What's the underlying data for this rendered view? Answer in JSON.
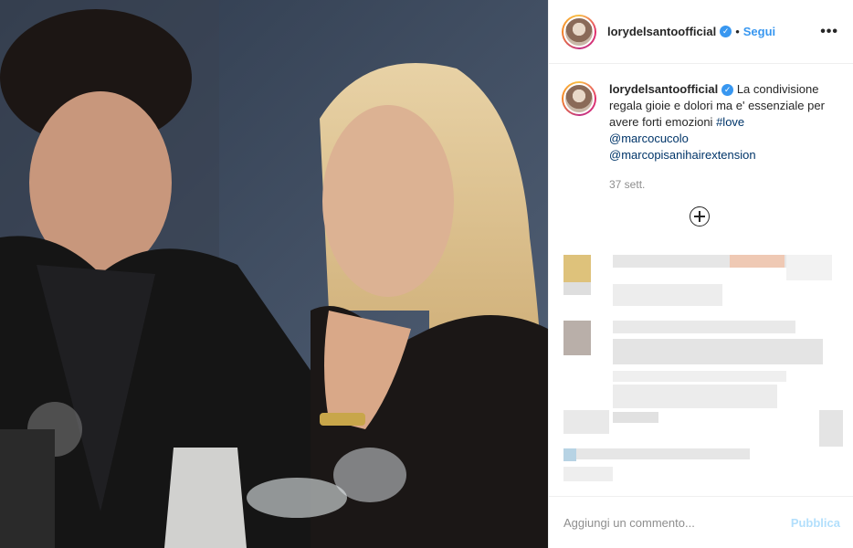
{
  "post": {
    "username": "lorydelsantoofficial",
    "verified_mark": "✓",
    "separator": "•",
    "follow_label": "Segui",
    "more_icon": "•••"
  },
  "caption": {
    "username": "lorydelsantoofficial",
    "text": "La condivisione regala gioie e dolori ma e' essenziale per avere forti emozioni",
    "hashtag": "#love",
    "mentions": [
      "@marcocucolo",
      "@marcopisanihairextension"
    ],
    "time": "37 sett."
  },
  "footer": {
    "placeholder": "Aggiungi un commento...",
    "publish_label": "Pubblica"
  },
  "colors": {
    "accent": "#3897f0",
    "link": "#003569",
    "muted": "#8e8e8e",
    "publish_disabled": "#b2dffc"
  },
  "icons": {
    "more": "more-options-icon",
    "add_comments": "plus-circle-icon",
    "verified": "verified-badge-icon"
  }
}
